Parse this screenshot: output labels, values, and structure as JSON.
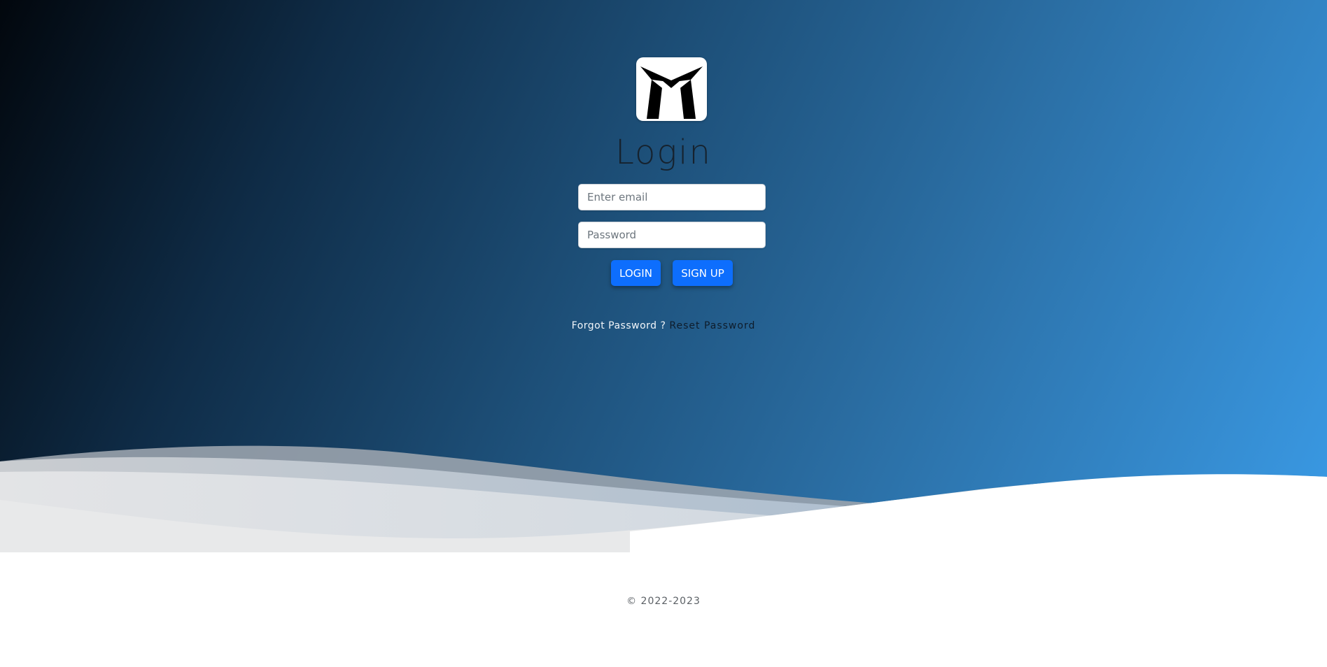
{
  "logo": {
    "icon": "m-logo-icon"
  },
  "login": {
    "title": "Login",
    "email_placeholder": "Enter email",
    "password_placeholder": "Password",
    "login_label": "LOGIN",
    "signup_label": "SIGN UP"
  },
  "forgot": {
    "question": "Forgot Password ?",
    "reset_label": "Reset Password"
  },
  "footer": {
    "copyright": "© 2022-2023"
  },
  "colors": {
    "button": "#0d6efd",
    "gradient_dark": "#02070d",
    "gradient_light": "#3a9ae5"
  }
}
